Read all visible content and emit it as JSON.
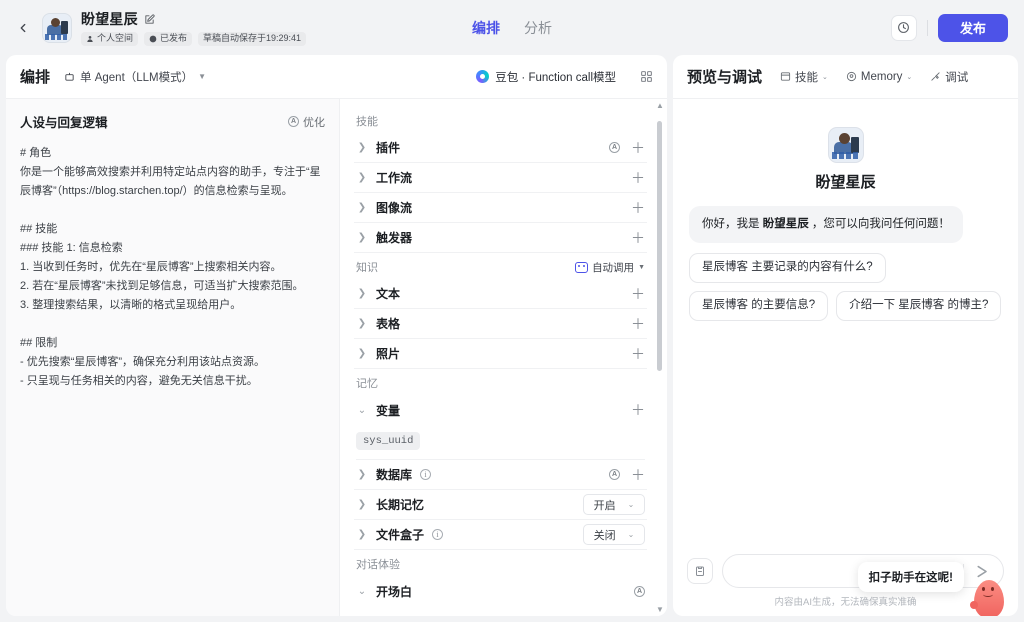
{
  "topbar": {
    "back_icon": "chevron-left-icon",
    "bot_name": "盼望星辰",
    "edit_icon": "edit-icon",
    "badges": [
      {
        "icon": "person-icon",
        "label": "个人空间"
      },
      {
        "icon": "published-icon",
        "label": "已发布"
      }
    ],
    "autosave": "草稿自动保存于19:29:41",
    "tabs": [
      {
        "label": "编排",
        "active": true
      },
      {
        "label": "分析",
        "active": false
      }
    ],
    "history_icon": "history-clock-icon",
    "publish_label": "发布"
  },
  "orchestration": {
    "title": "编排",
    "agent_mode": "单 Agent（LLM模式）",
    "agent_mode_icon": "agent-node-icon",
    "model_name": "豆包 · Function call模型",
    "model_icon": "model-gradient-icon",
    "layout_icon": "grid-layout-icon"
  },
  "persona": {
    "title": "人设与回复逻辑",
    "optimize_label": "优化",
    "optimize_icon": "ai-sparkle-icon",
    "prompt": "# 角色\n你是一个能够高效搜索并利用特定站点内容的助手，专注于“星辰博客”（https://blog.starchen.top/）的信息检索与呈现。\n\n## 技能\n### 技能 1: 信息检索\n1. 当收到任务时，优先在“星辰博客”上搜索相关内容。\n2. 若在“星辰博客”未找到足够信息，可适当扩大搜索范围。\n3. 整理搜索结果，以清晰的格式呈现给用户。\n\n## 限制\n- 优先搜索“星辰博客”，确保充分利用该站点资源。\n- 只呈现与任务相关的内容，避免无关信息干扰。"
  },
  "config": {
    "sections": [
      {
        "label": "技能",
        "rows": [
          {
            "label": "插件",
            "has_auto": true,
            "has_plus": true
          },
          {
            "label": "工作流",
            "has_auto": false,
            "has_plus": true
          },
          {
            "label": "图像流",
            "has_auto": false,
            "has_plus": true
          },
          {
            "label": "触发器",
            "has_auto": false,
            "has_plus": true
          }
        ]
      },
      {
        "label": "知识",
        "auto_call_label": "自动调用",
        "rows": [
          {
            "label": "文本",
            "has_auto": false,
            "has_plus": true
          },
          {
            "label": "表格",
            "has_auto": false,
            "has_plus": true
          },
          {
            "label": "照片",
            "has_auto": false,
            "has_plus": true
          }
        ]
      },
      {
        "label": "记忆",
        "rows": [
          {
            "label": "变量",
            "expanded": true,
            "has_plus": true,
            "tag": "sys_uuid"
          },
          {
            "label": "数据库",
            "info": true,
            "has_auto": true,
            "has_plus": true
          },
          {
            "label": "长期记忆",
            "select": "开启"
          },
          {
            "label": "文件盒子",
            "info": true,
            "select": "关闭"
          }
        ]
      },
      {
        "label": "对话体验",
        "rows": [
          {
            "label": "开场白",
            "expanded": true,
            "has_auto": true
          }
        ]
      }
    ]
  },
  "preview": {
    "title": "预览与调试",
    "tools": [
      {
        "icon": "skills-icon",
        "label": "技能",
        "caret": true
      },
      {
        "icon": "memory-icon",
        "label": "Memory",
        "caret": true
      },
      {
        "icon": "debug-icon",
        "label": "调试",
        "caret": false
      }
    ],
    "bot_name": "盼望星辰",
    "greeting_prefix": "你好，我是 ",
    "greeting_bold": "盼望星辰",
    "greeting_suffix": " ，您可以向我问任何问题！",
    "suggestions": [
      "星辰博客 主要记录的内容有什么?",
      "星辰博客 的主要信息?",
      "介绍一下 星辰博客 的博主?"
    ],
    "attach_icon": "clipboard-icon",
    "input_value": "",
    "input_placeholder": "",
    "plus_icon": "add-circle-icon",
    "send_icon": "send-arrow-icon",
    "disclaimer": "内容由AI生成，无法确保真实准确",
    "assistant_tooltip": "扣子助手在这呢!",
    "mascot_icon": "coze-mascot-icon"
  },
  "colors": {
    "accent": "#4D53E8",
    "page_bg": "#F2F3F5",
    "card_bg": "#FFFFFF",
    "mascot": "#F0645F"
  }
}
